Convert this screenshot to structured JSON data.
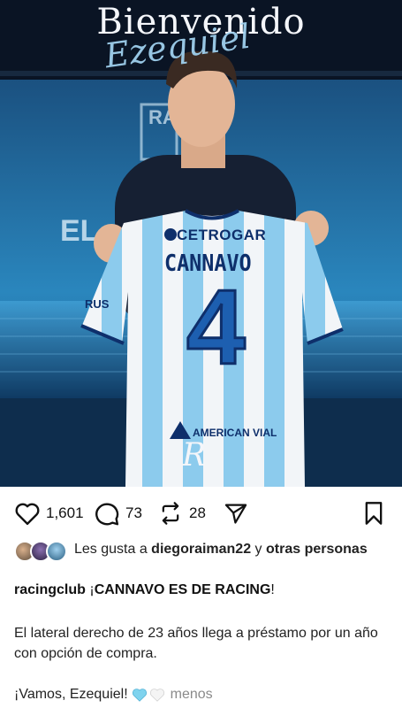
{
  "post": {
    "banner_title": "Bienvenido",
    "banner_subtitle": "Ezequiel",
    "jersey_sponsor": "CETROGAR",
    "jersey_name": "CANNAVO",
    "jersey_number": "4",
    "jersey_sponsor_bottom": "AMERICAN VIAL",
    "crest_letter": "R"
  },
  "actions": {
    "like_count": "1,601",
    "comment_count": "73",
    "repost_count": "28"
  },
  "likes": {
    "prefix": "Les gusta a ",
    "user": "diegoraiman22",
    "middle": " y ",
    "suffix": "otras personas"
  },
  "caption": {
    "username": "racingclub",
    "headline_open": " ¡",
    "headline": "CANNAVO ES DE RACING",
    "headline_close": "!",
    "body": "El lateral derecho de 23 años llega a préstamo por un año con opción de compra.",
    "closing": "¡Vamos, Ezequiel!",
    "more": "menos"
  },
  "colors": {
    "sky_blue": "#6ec6f0",
    "navy": "#0e2f6b",
    "heart_light": "#7fd3ee",
    "heart_white": "#f1f1f1"
  }
}
